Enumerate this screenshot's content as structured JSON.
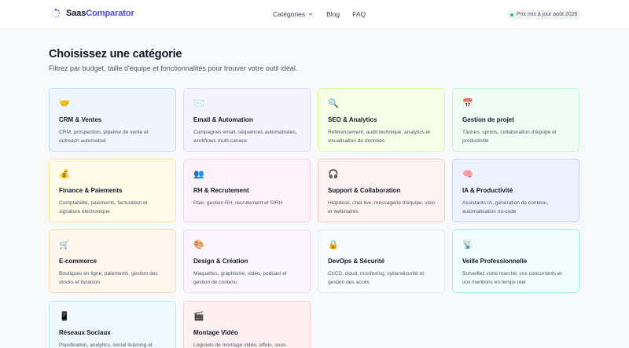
{
  "header": {
    "logo_saas": "Saas",
    "logo_comp": "Comparator",
    "nav": {
      "categories": "Catégories",
      "blog": "Blog",
      "faq": "FAQ"
    },
    "price_badge": "Prix mis à jour août 2026"
  },
  "main": {
    "title": "Choisissez une catégorie",
    "subtitle": "Filtrez par budget, taille d'équipe et fonctionnalités pour trouver votre outil idéal."
  },
  "colors": {
    "accent": "#4f46e5",
    "status_green": "#22c55e"
  },
  "categories": [
    {
      "icon": "handshake-icon",
      "emoji": "🤝",
      "name": "CRM & Ventes",
      "desc": "CRM, prospection, pipeline de vente et outreach automatisé",
      "bg": "#eff6ff",
      "border": "#bfdbfe"
    },
    {
      "icon": "envelope-icon",
      "emoji": "✉️",
      "name": "Email & Automation",
      "desc": "Campagnes email, séquences automatisées, workflows multi-canaux",
      "bg": "#f5f3ff",
      "border": "#ddd6fe"
    },
    {
      "icon": "magnifier-icon",
      "emoji": "🔍",
      "name": "SEO & Analytics",
      "desc": "Référencement, audit technique, analytics et visualisation de données",
      "bg": "#f7fee7",
      "border": "#d9f99d"
    },
    {
      "icon": "calendar-icon",
      "emoji": "📅",
      "name": "Gestion de projet",
      "desc": "Tâches, sprints, collaboration d'équipe et productivité",
      "bg": "#f0fdf4",
      "border": "#bbf7d0"
    },
    {
      "icon": "money-bag-icon",
      "emoji": "💰",
      "name": "Finance & Paiements",
      "desc": "Comptabilité, paiements, facturation et signature électronique",
      "bg": "#fefce8",
      "border": "#fde68a"
    },
    {
      "icon": "people-icon",
      "emoji": "👥",
      "name": "RH & Recrutement",
      "desc": "Paie, gestion RH, recrutement et SIRH",
      "bg": "#fdf2f8",
      "border": "#fbcfe8"
    },
    {
      "icon": "headphones-icon",
      "emoji": "🎧",
      "name": "Support & Collaboration",
      "desc": "Helpdesk, chat live, messagerie d'équipe, visio et webinaires",
      "bg": "#fef2f2",
      "border": "#fecaca"
    },
    {
      "icon": "brain-icon",
      "emoji": "🧠",
      "name": "IA & Productivité",
      "desc": "Assistants IA, génération de contenu, automatisation no-code",
      "bg": "#eef2ff",
      "border": "#c7d2fe"
    },
    {
      "icon": "cart-icon",
      "emoji": "🛒",
      "name": "E-commerce",
      "desc": "Boutiques en ligne, paiements, gestion des stocks et livraison",
      "bg": "#fff7ed",
      "border": "#fed7aa"
    },
    {
      "icon": "palette-icon",
      "emoji": "🎨",
      "name": "Design & Création",
      "desc": "Maquettes, graphisme, vidéo, podcast et gestion de contenu",
      "bg": "#faf5ff",
      "border": "#e9d5ff"
    },
    {
      "icon": "lock-icon",
      "emoji": "🔒",
      "name": "DevOps & Sécurité",
      "desc": "CI/CD, cloud, monitoring, cybersécurité et gestion des accès",
      "bg": "#f9fafb",
      "border": "#e5e7eb"
    },
    {
      "icon": "satellite-dish-icon",
      "emoji": "📡",
      "name": "Veille Professionnelle",
      "desc": "Surveillez votre marché, vos concurrents et vos mentions en temps réel",
      "bg": "#f0fdfa",
      "border": "#99f6e4"
    },
    {
      "icon": "mobile-phone-icon",
      "emoji": "📱",
      "name": "Réseaux Sociaux",
      "desc": "Planification, analytics, social listening et",
      "bg": "#f0f9ff",
      "border": "#bae6fd"
    },
    {
      "icon": "clapper-board-icon",
      "emoji": "🎬",
      "name": "Montage Vidéo",
      "desc": "Logiciels de montage vidéo, effets, sous-",
      "bg": "#fff1f2",
      "border": "#fecdd3"
    }
  ]
}
